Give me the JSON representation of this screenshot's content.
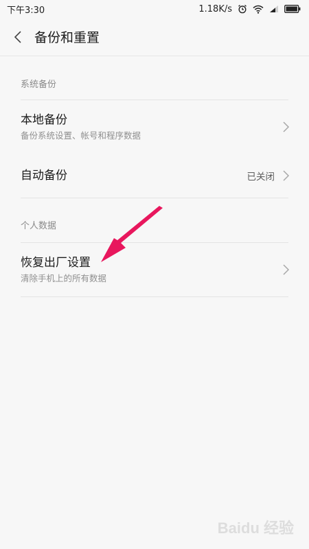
{
  "status_bar": {
    "time": "下午3:30",
    "network_speed": "1.18K/s",
    "icons": [
      "alarm-icon",
      "wifi-icon",
      "signal-icon",
      "battery-icon"
    ]
  },
  "header": {
    "back_icon": "chevron-left-icon",
    "title": "备份和重置"
  },
  "sections": [
    {
      "label": "系统备份",
      "items": [
        {
          "title": "本地备份",
          "subtitle": "备份系统设置、帐号和程序数据"
        },
        {
          "title": "自动备份",
          "value": "已关闭"
        }
      ]
    },
    {
      "label": "个人数据",
      "items": [
        {
          "title": "恢复出厂设置",
          "subtitle": "清除手机上的所有数据"
        }
      ]
    }
  ],
  "annotation": {
    "color": "#e8175d"
  },
  "watermark": "Baidu 经验",
  "colors": {
    "background": "#f7f7f7",
    "divider": "#e3e3e3",
    "secondary_text": "#8f8f8f"
  }
}
